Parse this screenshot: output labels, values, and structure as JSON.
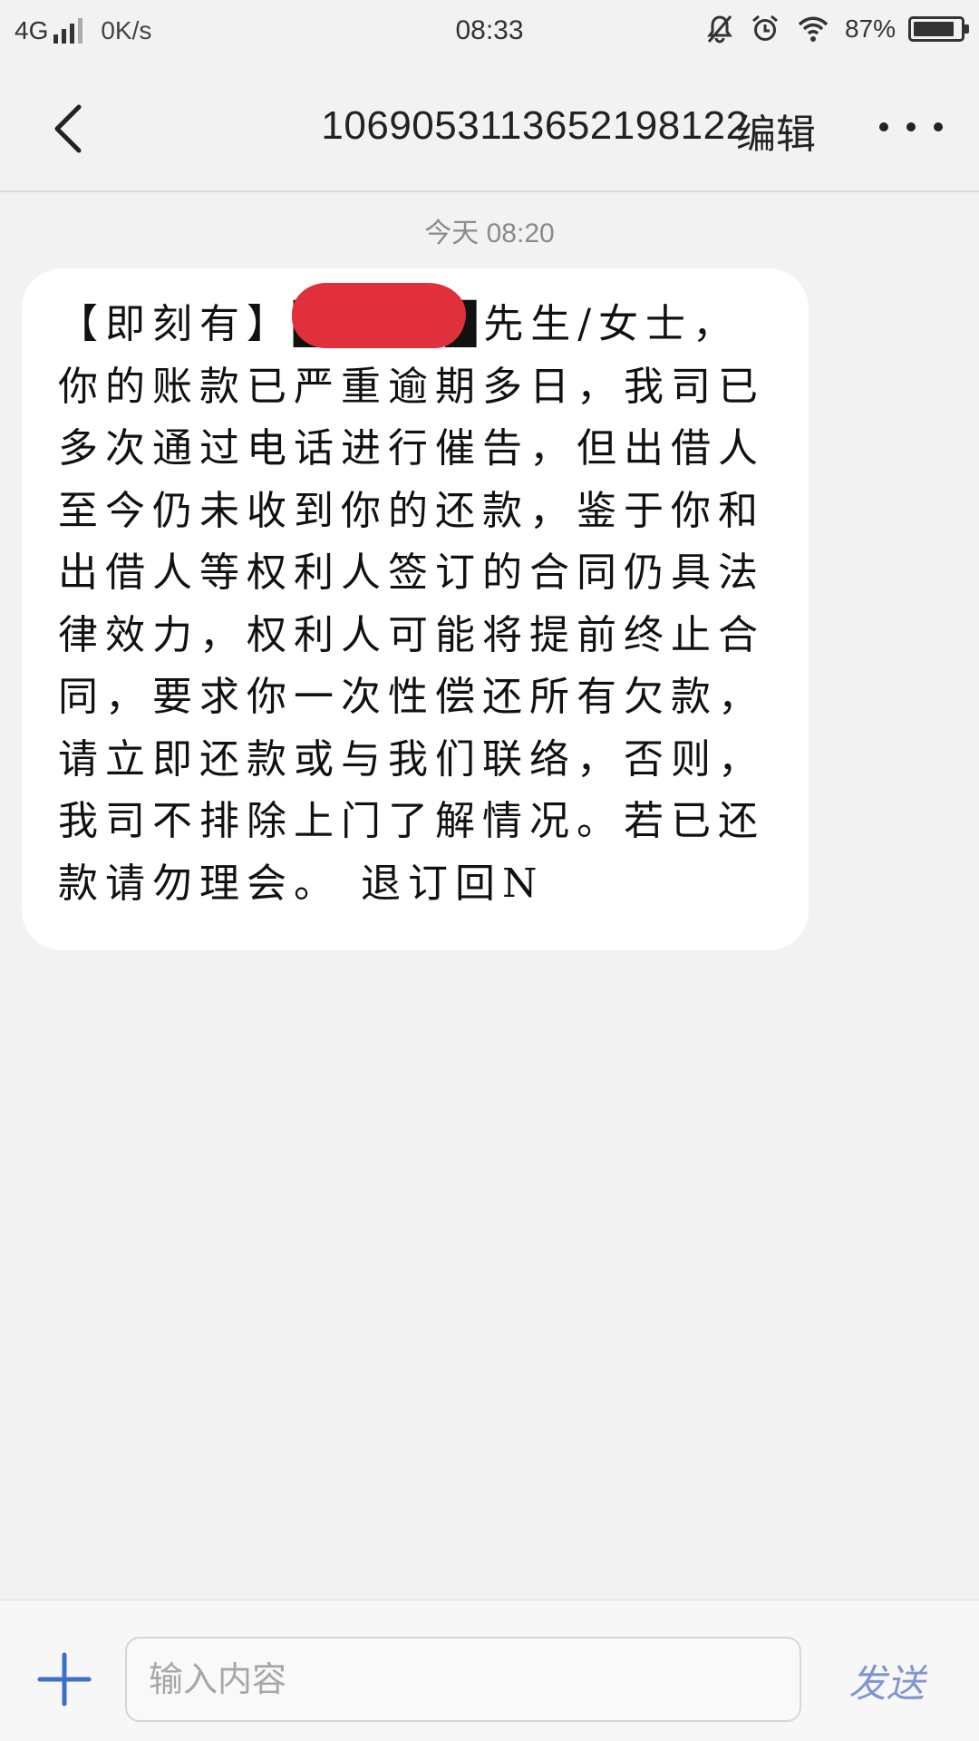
{
  "status_bar": {
    "network": "4G",
    "speed": "0K/s",
    "time": "08:33",
    "battery_percent": "87%",
    "battery_level": 0.87,
    "icons": [
      "signal-icon",
      "mute-bell-icon",
      "alarm-icon",
      "wifi-icon",
      "battery-icon"
    ]
  },
  "header": {
    "back_icon": "chevron-left-icon",
    "title": "1069053113652198122",
    "edit_label": "编辑",
    "more_icon": "more-dots-icon"
  },
  "conversation": {
    "timestamp": "今天 08:20",
    "messages": [
      {
        "text": "【即刻有】█████先生/女士，你的账款已严重逾期多日，我司已多次通过电话进行催告，但出借人至今仍未收到你的还款，鉴于你和出借人等权利人签订的合同仍具法律效力，权利人可能将提前终止合同，要求你一次性偿还所有欠款，请立即还款或与我们联络，否则，我司不排除上门了解情况。若已还款请勿理会。 退订回N",
        "redacted": true
      }
    ]
  },
  "input_bar": {
    "plus_icon": "plus-icon",
    "placeholder": "输入内容",
    "value": "",
    "send_label": "发送"
  },
  "colors": {
    "background": "#f2f2f2",
    "bubble": "#ffffff",
    "accent_blue": "#3a6fd0",
    "send_text": "#7f96d0",
    "redaction": "#e0303b"
  }
}
